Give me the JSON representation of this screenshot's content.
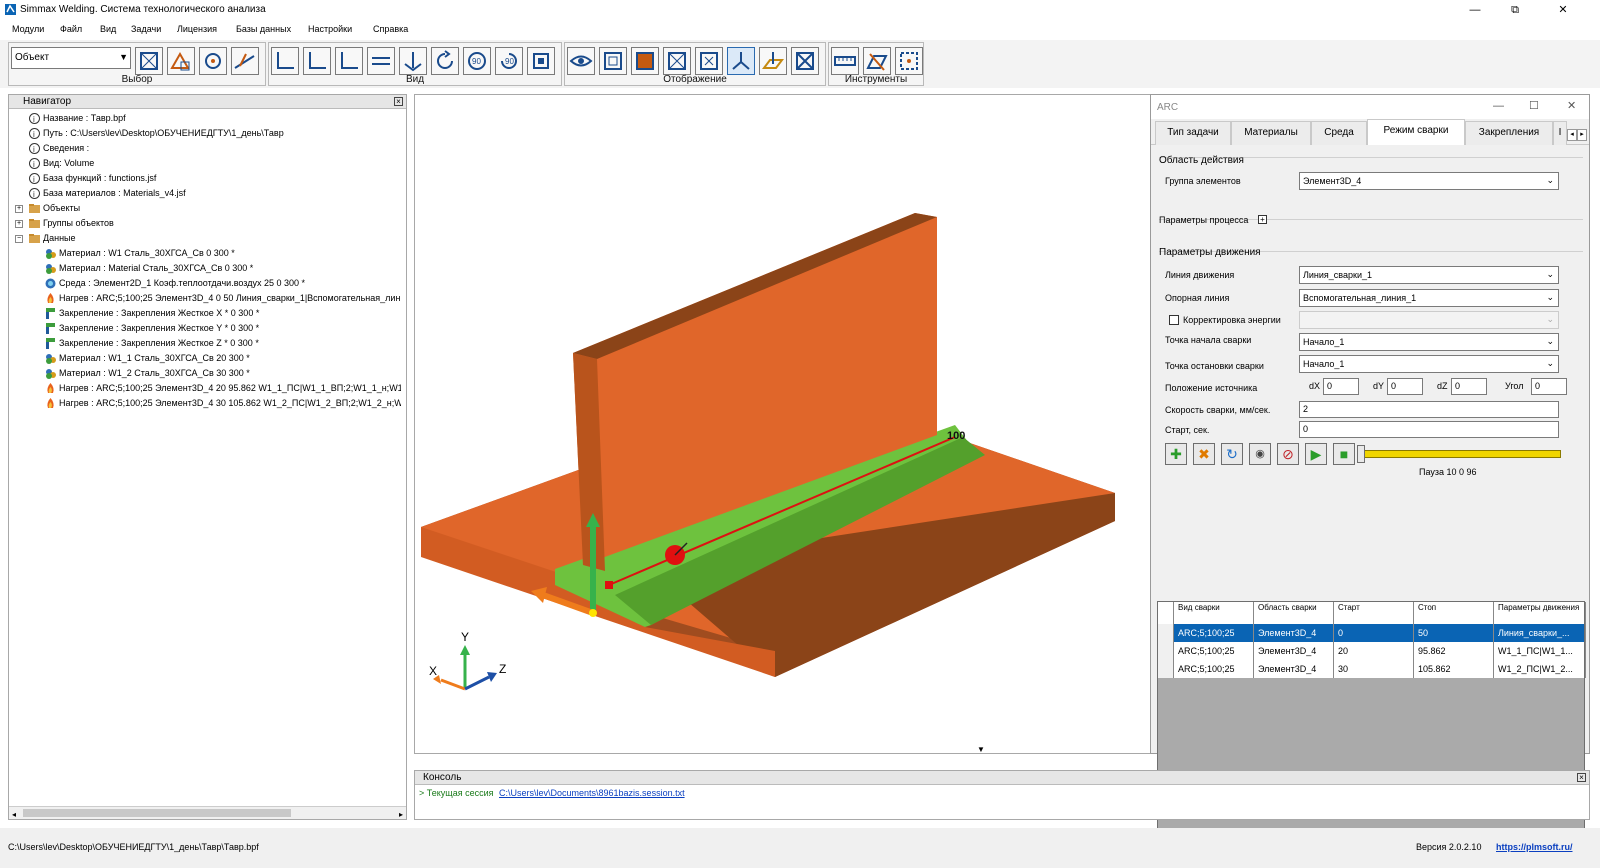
{
  "app": {
    "title": "Simmax Welding. Система технологического анализа",
    "win_min": "—",
    "win_max": "⧉",
    "win_close": "✕"
  },
  "menu": [
    "Модули",
    "Файл",
    "Вид",
    "Задачи",
    "Лицензия",
    "Базы данных",
    "Настройки",
    "Справка"
  ],
  "toolbar": {
    "object_select": "Объект",
    "groups": {
      "select": "Выбор",
      "view": "Вид",
      "display": "Отображение",
      "tools": "Инструменты"
    }
  },
  "navigator": {
    "title": "Навигатор",
    "close": "×",
    "items": [
      "Название : Тавр.bpf",
      "Путь : C:\\Users\\lev\\Desktop\\ОБУЧЕНИЕДГТУ\\1_день\\Тавр",
      "Сведения :",
      "Вид: Volume",
      "База функций : functions.jsf",
      "База материалов : Materials_v4.jsf",
      "Объекты",
      "Группы объектов",
      "Данные",
      "Материал : W1 Сталь_30ХГСА_Св 0 300 *",
      "Материал : Material Сталь_30ХГСА_Св 0 300 *",
      "Среда : Элемент2D_1 Коэф.теплоотдачи.воздух 25 0 300 *",
      "Нагрев : ARC;5;100;25 Элемент3D_4 0 50 Линия_сварки_1|Вспомогательная_лин",
      "Закрепление : Закрепления Жесткое X * 0 300 *",
      "Закрепление : Закрепления Жесткое Y * 0 300 *",
      "Закрепление : Закрепления Жесткое Z * 0 300 *",
      "Материал : W1_1 Сталь_30ХГСА_Св 20 300 *",
      "Материал : W1_2 Сталь_30ХГСА_Св 30 300 *",
      "Нагрев : ARC;5;100;25 Элемент3D_4 20 95.862 W1_1_ПС|W1_1_ВП;2;W1_1_н;W1",
      "Нагрев : ARC;5;100;25 Элемент3D_4 30 105.862 W1_2_ПС|W1_2_ВП;2;W1_2_н;W"
    ]
  },
  "viewport": {
    "axis_x": "X",
    "axis_y": "Y",
    "axis_z": "Z",
    "weld_label": "100"
  },
  "arc": {
    "title": "ARC",
    "tabs": [
      "Тип задачи",
      "Материалы",
      "Среда",
      "Режим сварки",
      "Закрепления",
      "I"
    ],
    "tab_nav": [
      "◂",
      "▸"
    ],
    "area_section": "Область действия",
    "group_label": "Группа элементов",
    "group_value": "Элемент3D_4",
    "process_params": "Параметры процесса",
    "motion_section": "Параметры движения",
    "motion_line_label": "Линия движения",
    "motion_line_value": "Линия_сварки_1",
    "ref_line_label": "Опорная линия",
    "ref_line_value": "Вспомогательная_линия_1",
    "energy_corr_label": "Корректировка энергии",
    "start_point_label": "Точка начала сварки",
    "start_point_value": "Начало_1",
    "stop_point_label": "Точка остановки сварки",
    "stop_point_value": "Начало_1",
    "source_pos_label": "Положение источника",
    "dx_label": "dX",
    "dx": "0",
    "dy_label": "dY",
    "dy": "0",
    "dz_label": "dZ",
    "dz": "0",
    "angle_label": "Угол",
    "angle": "0",
    "speed_label": "Скорость сварки, мм/сек.",
    "speed": "2",
    "start_label": "Старт, сек.",
    "start": "0",
    "pause_text": "Пауза 10 0 96",
    "table": {
      "headers": [
        "Вид сварки",
        "Область сварки",
        "Старт",
        "Стоп",
        "Параметры движения"
      ],
      "rows": [
        [
          "ARC;5;100;25",
          "Элемент3D_4",
          "0",
          "50",
          "Линия_сварки_..."
        ],
        [
          "ARC;5;100;25",
          "Элемент3D_4",
          "20",
          "95.862",
          "W1_1_ПС|W1_1..."
        ],
        [
          "ARC;5;100;25",
          "Элемент3D_4",
          "30",
          "105.862",
          "W1_2_ПС|W1_2..."
        ]
      ]
    }
  },
  "console": {
    "title": "Консоль",
    "session_label": "> Текущая сессия",
    "session_path": "C:\\Users\\lev\\Documents\\8961bazis.session.txt"
  },
  "status": {
    "path": "C:\\Users\\lev\\Desktop\\ОБУЧЕНИЕДГТУ\\1_день\\Тавр\\Тавр.bpf",
    "version": "Версия 2.0.2.10",
    "site": "https://plmsoft.ru/"
  },
  "colors": {
    "accent": "#0a64b4",
    "plate": "#e0662a",
    "weld_zone": "#6ec23e"
  }
}
